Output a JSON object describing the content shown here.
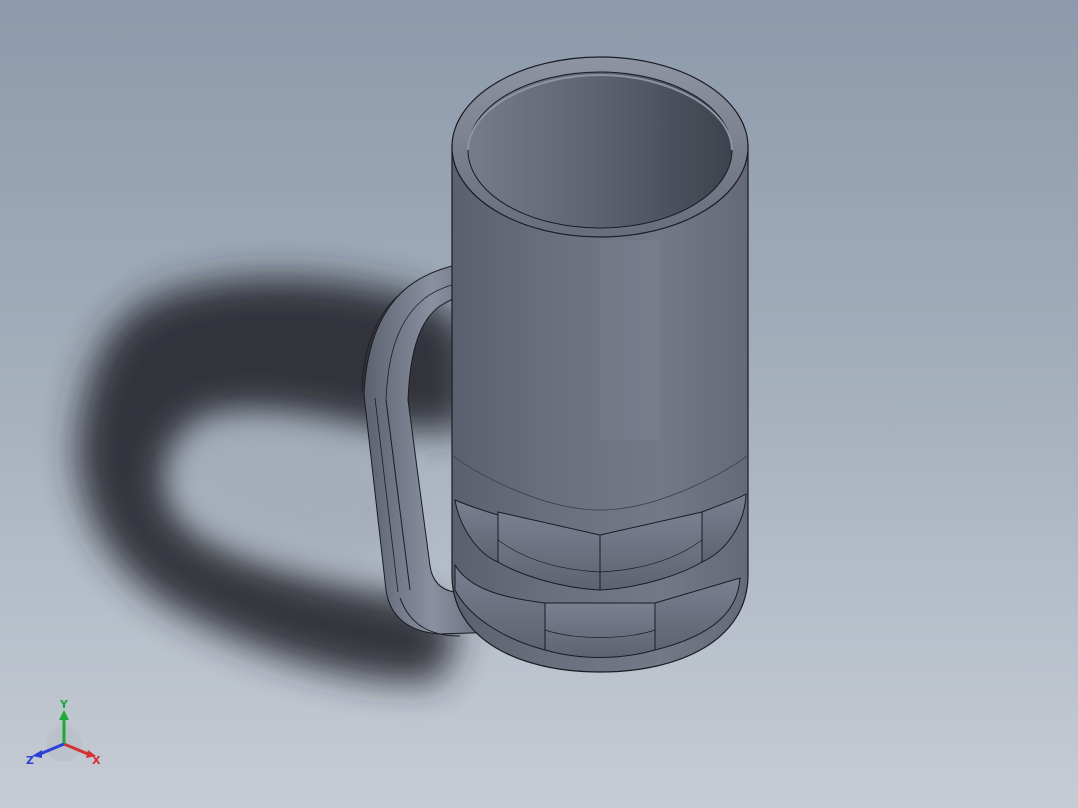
{
  "viewport": {
    "background_top": "#8d9aab",
    "background_bottom": "#c6ccd5"
  },
  "model": {
    "part": "beer mug",
    "body_color": "#656c7a",
    "edge_color": "#1a1c22",
    "shadow_color": "#25282d"
  },
  "triad": {
    "x_label": "X",
    "y_label": "Y",
    "z_label": "Z",
    "x_color": "#d23333",
    "y_color": "#1fa83a",
    "z_color": "#2c3fd6"
  }
}
